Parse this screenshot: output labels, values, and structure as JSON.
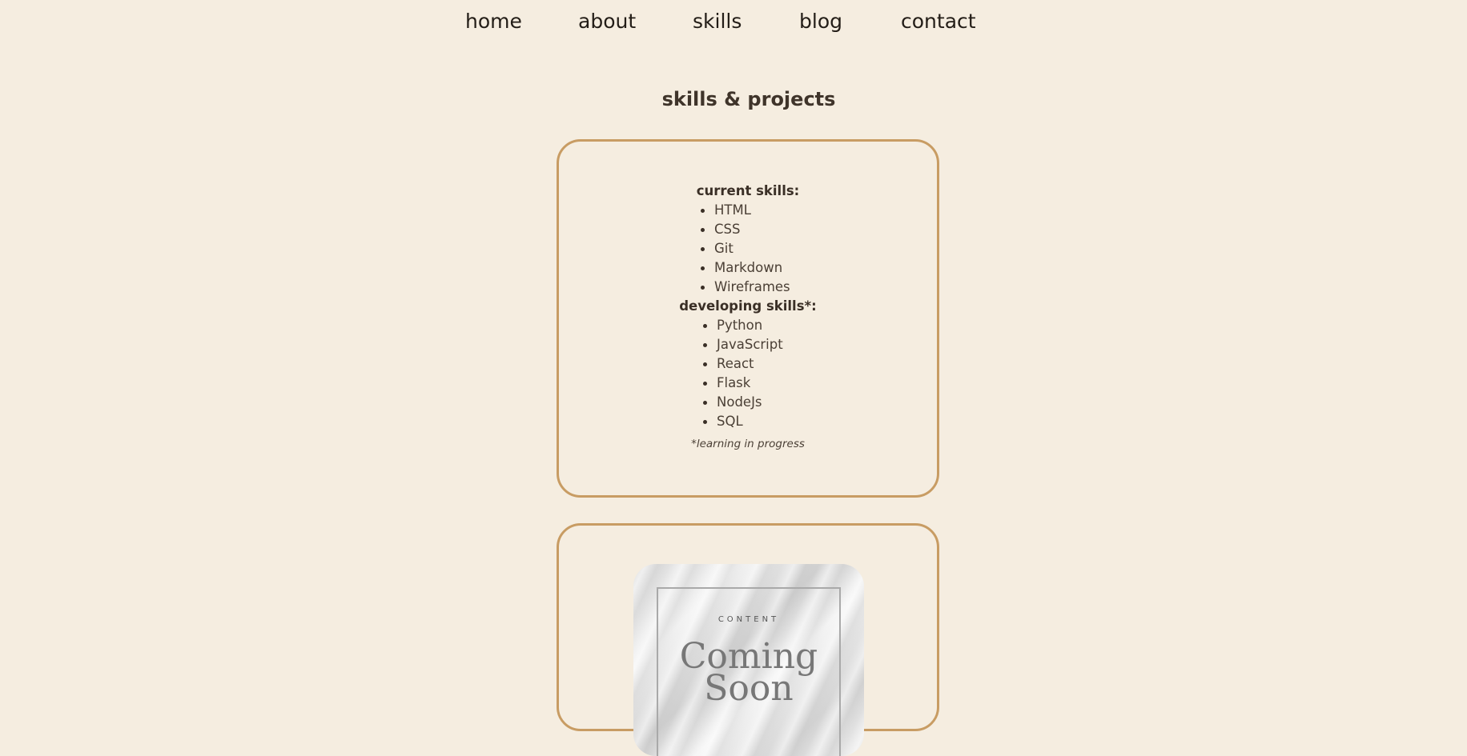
{
  "nav": {
    "items": [
      {
        "label": "home"
      },
      {
        "label": "about"
      },
      {
        "label": "skills"
      },
      {
        "label": "blog"
      },
      {
        "label": "contact"
      }
    ]
  },
  "page": {
    "title": "skills & projects"
  },
  "skills_card": {
    "current_heading": "current skills:",
    "current_skills": [
      "HTML",
      "CSS",
      "Git",
      "Markdown",
      "Wireframes"
    ],
    "developing_heading": "developing skills*:",
    "developing_skills": [
      "Python",
      "JavaScript",
      "React",
      "Flask",
      "NodeJs",
      "SQL"
    ],
    "footnote": "*learning in progress"
  },
  "project_card": {
    "image_caption": "CONTENT",
    "image_title_line1": "Coming",
    "image_title_line2": "Soon"
  },
  "colors": {
    "background": "#f5ede0",
    "card_border": "#c89c63",
    "text": "#4a3f35"
  }
}
